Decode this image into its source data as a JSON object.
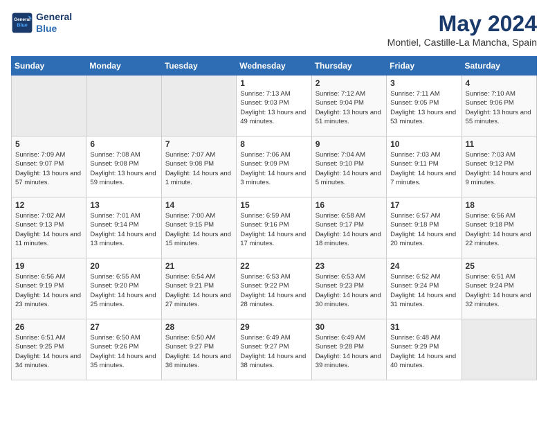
{
  "header": {
    "logo_general": "General",
    "logo_blue": "Blue",
    "month_title": "May 2024",
    "location": "Montiel, Castille-La Mancha, Spain"
  },
  "weekdays": [
    "Sunday",
    "Monday",
    "Tuesday",
    "Wednesday",
    "Thursday",
    "Friday",
    "Saturday"
  ],
  "weeks": [
    [
      {
        "day": "",
        "empty": true
      },
      {
        "day": "",
        "empty": true
      },
      {
        "day": "",
        "empty": true
      },
      {
        "day": "1",
        "sunrise": "7:13 AM",
        "sunset": "9:03 PM",
        "daylight": "13 hours and 49 minutes."
      },
      {
        "day": "2",
        "sunrise": "7:12 AM",
        "sunset": "9:04 PM",
        "daylight": "13 hours and 51 minutes."
      },
      {
        "day": "3",
        "sunrise": "7:11 AM",
        "sunset": "9:05 PM",
        "daylight": "13 hours and 53 minutes."
      },
      {
        "day": "4",
        "sunrise": "7:10 AM",
        "sunset": "9:06 PM",
        "daylight": "13 hours and 55 minutes."
      }
    ],
    [
      {
        "day": "5",
        "sunrise": "7:09 AM",
        "sunset": "9:07 PM",
        "daylight": "13 hours and 57 minutes."
      },
      {
        "day": "6",
        "sunrise": "7:08 AM",
        "sunset": "9:08 PM",
        "daylight": "13 hours and 59 minutes."
      },
      {
        "day": "7",
        "sunrise": "7:07 AM",
        "sunset": "9:08 PM",
        "daylight": "14 hours and 1 minute."
      },
      {
        "day": "8",
        "sunrise": "7:06 AM",
        "sunset": "9:09 PM",
        "daylight": "14 hours and 3 minutes."
      },
      {
        "day": "9",
        "sunrise": "7:04 AM",
        "sunset": "9:10 PM",
        "daylight": "14 hours and 5 minutes."
      },
      {
        "day": "10",
        "sunrise": "7:03 AM",
        "sunset": "9:11 PM",
        "daylight": "14 hours and 7 minutes."
      },
      {
        "day": "11",
        "sunrise": "7:03 AM",
        "sunset": "9:12 PM",
        "daylight": "14 hours and 9 minutes."
      }
    ],
    [
      {
        "day": "12",
        "sunrise": "7:02 AM",
        "sunset": "9:13 PM",
        "daylight": "14 hours and 11 minutes."
      },
      {
        "day": "13",
        "sunrise": "7:01 AM",
        "sunset": "9:14 PM",
        "daylight": "14 hours and 13 minutes."
      },
      {
        "day": "14",
        "sunrise": "7:00 AM",
        "sunset": "9:15 PM",
        "daylight": "14 hours and 15 minutes."
      },
      {
        "day": "15",
        "sunrise": "6:59 AM",
        "sunset": "9:16 PM",
        "daylight": "14 hours and 17 minutes."
      },
      {
        "day": "16",
        "sunrise": "6:58 AM",
        "sunset": "9:17 PM",
        "daylight": "14 hours and 18 minutes."
      },
      {
        "day": "17",
        "sunrise": "6:57 AM",
        "sunset": "9:18 PM",
        "daylight": "14 hours and 20 minutes."
      },
      {
        "day": "18",
        "sunrise": "6:56 AM",
        "sunset": "9:18 PM",
        "daylight": "14 hours and 22 minutes."
      }
    ],
    [
      {
        "day": "19",
        "sunrise": "6:56 AM",
        "sunset": "9:19 PM",
        "daylight": "14 hours and 23 minutes."
      },
      {
        "day": "20",
        "sunrise": "6:55 AM",
        "sunset": "9:20 PM",
        "daylight": "14 hours and 25 minutes."
      },
      {
        "day": "21",
        "sunrise": "6:54 AM",
        "sunset": "9:21 PM",
        "daylight": "14 hours and 27 minutes."
      },
      {
        "day": "22",
        "sunrise": "6:53 AM",
        "sunset": "9:22 PM",
        "daylight": "14 hours and 28 minutes."
      },
      {
        "day": "23",
        "sunrise": "6:53 AM",
        "sunset": "9:23 PM",
        "daylight": "14 hours and 30 minutes."
      },
      {
        "day": "24",
        "sunrise": "6:52 AM",
        "sunset": "9:24 PM",
        "daylight": "14 hours and 31 minutes."
      },
      {
        "day": "25",
        "sunrise": "6:51 AM",
        "sunset": "9:24 PM",
        "daylight": "14 hours and 32 minutes."
      }
    ],
    [
      {
        "day": "26",
        "sunrise": "6:51 AM",
        "sunset": "9:25 PM",
        "daylight": "14 hours and 34 minutes."
      },
      {
        "day": "27",
        "sunrise": "6:50 AM",
        "sunset": "9:26 PM",
        "daylight": "14 hours and 35 minutes."
      },
      {
        "day": "28",
        "sunrise": "6:50 AM",
        "sunset": "9:27 PM",
        "daylight": "14 hours and 36 minutes."
      },
      {
        "day": "29",
        "sunrise": "6:49 AM",
        "sunset": "9:27 PM",
        "daylight": "14 hours and 38 minutes."
      },
      {
        "day": "30",
        "sunrise": "6:49 AM",
        "sunset": "9:28 PM",
        "daylight": "14 hours and 39 minutes."
      },
      {
        "day": "31",
        "sunrise": "6:48 AM",
        "sunset": "9:29 PM",
        "daylight": "14 hours and 40 minutes."
      },
      {
        "day": "",
        "empty": true
      }
    ]
  ]
}
